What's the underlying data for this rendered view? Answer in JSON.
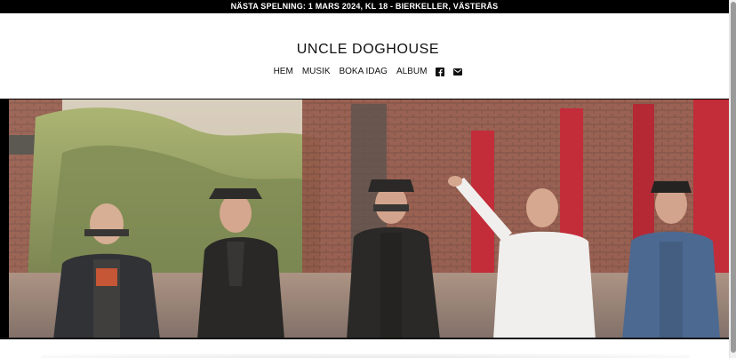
{
  "announcement": "NÄSTA SPELNING: 1 MARS 2024, KL 18 - BIERKELLER, VÄSTERÅS",
  "site_title": "UNCLE DOGHOUSE",
  "nav": {
    "items": [
      {
        "label": "HEM"
      },
      {
        "label": "MUSIK"
      },
      {
        "label": "BOKA IDAG"
      },
      {
        "label": "ALBUM"
      }
    ],
    "icons": [
      "facebook-icon",
      "mail-icon"
    ]
  },
  "hero": {
    "subject": "band-photo"
  },
  "colors": {
    "announcement_bg": "#000000",
    "announcement_text": "#ffffff",
    "page_bg": "#ffffff",
    "brick": "#8f4b3d",
    "red_door": "#c21f2f"
  }
}
